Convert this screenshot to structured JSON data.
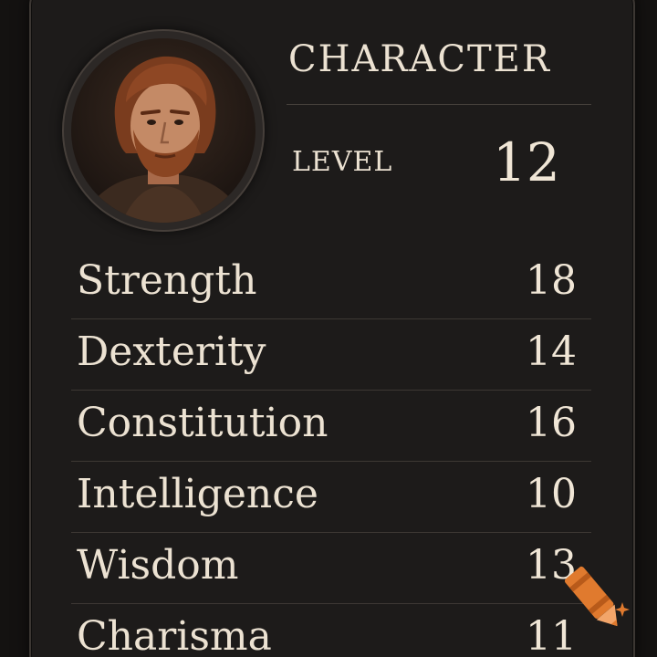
{
  "header": {
    "title": "CHARACTER",
    "level_label": "LEVEL",
    "level_value": "12"
  },
  "portrait": {
    "icon": "character-portrait"
  },
  "stats": [
    {
      "name": "Strength",
      "value": "18"
    },
    {
      "name": "Dexterity",
      "value": "14"
    },
    {
      "name": "Constitution",
      "value": "16"
    },
    {
      "name": "Intelligence",
      "value": "10"
    },
    {
      "name": "Wisdom",
      "value": "13"
    },
    {
      "name": "Charisma",
      "value": "11"
    }
  ],
  "colors": {
    "background": "#141211",
    "panel": "#1d1b1a",
    "text": "#ece2d2",
    "accent": "#e07a2e"
  },
  "watermark": {
    "icon": "crayon-icon"
  }
}
